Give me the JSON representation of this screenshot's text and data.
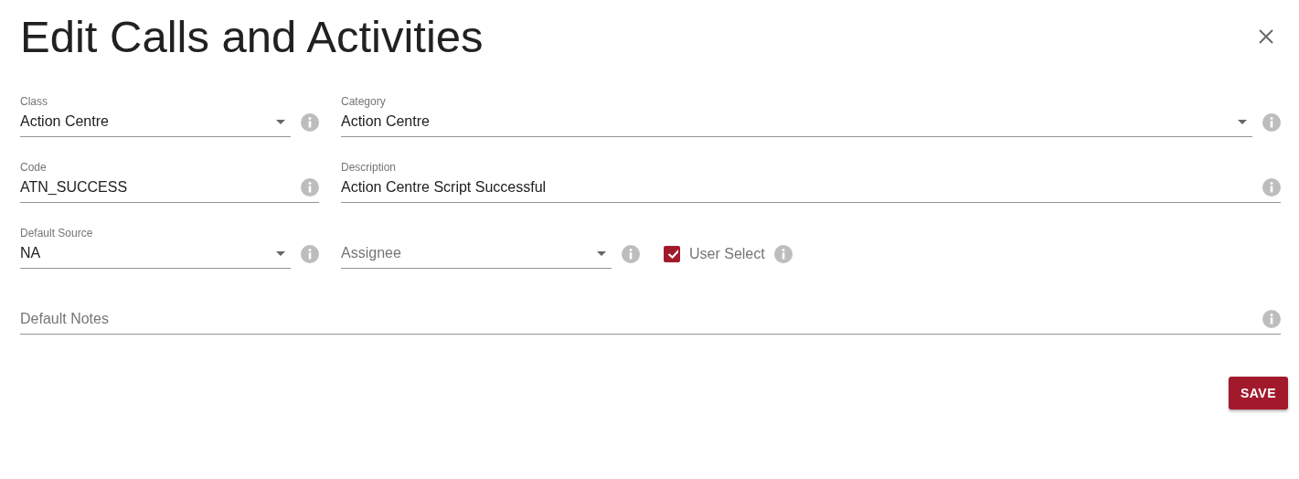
{
  "dialog": {
    "title": "Edit Calls and Activities"
  },
  "rows": [
    {
      "items": [
        {
          "kind": "select",
          "label": "Class",
          "value": "Action Centre"
        },
        {
          "kind": "select",
          "label": "Category",
          "value": "Action Centre"
        }
      ]
    },
    {
      "items": [
        {
          "kind": "text",
          "label": "Code",
          "value": "ATN_SUCCESS"
        },
        {
          "kind": "text",
          "label": "Description",
          "value": "Action Centre Script Successful"
        }
      ]
    },
    {
      "items": [
        {
          "kind": "select",
          "label": "Default Source",
          "value": "NA"
        },
        {
          "kind": "select",
          "placeholder": "Assignee"
        },
        {
          "kind": "checkbox",
          "label": "User Select",
          "checked": true
        }
      ]
    },
    {
      "items": [
        {
          "kind": "text",
          "placeholder": "Default Notes"
        }
      ]
    }
  ],
  "buttons": [
    {
      "label": "SAVE"
    }
  ]
}
